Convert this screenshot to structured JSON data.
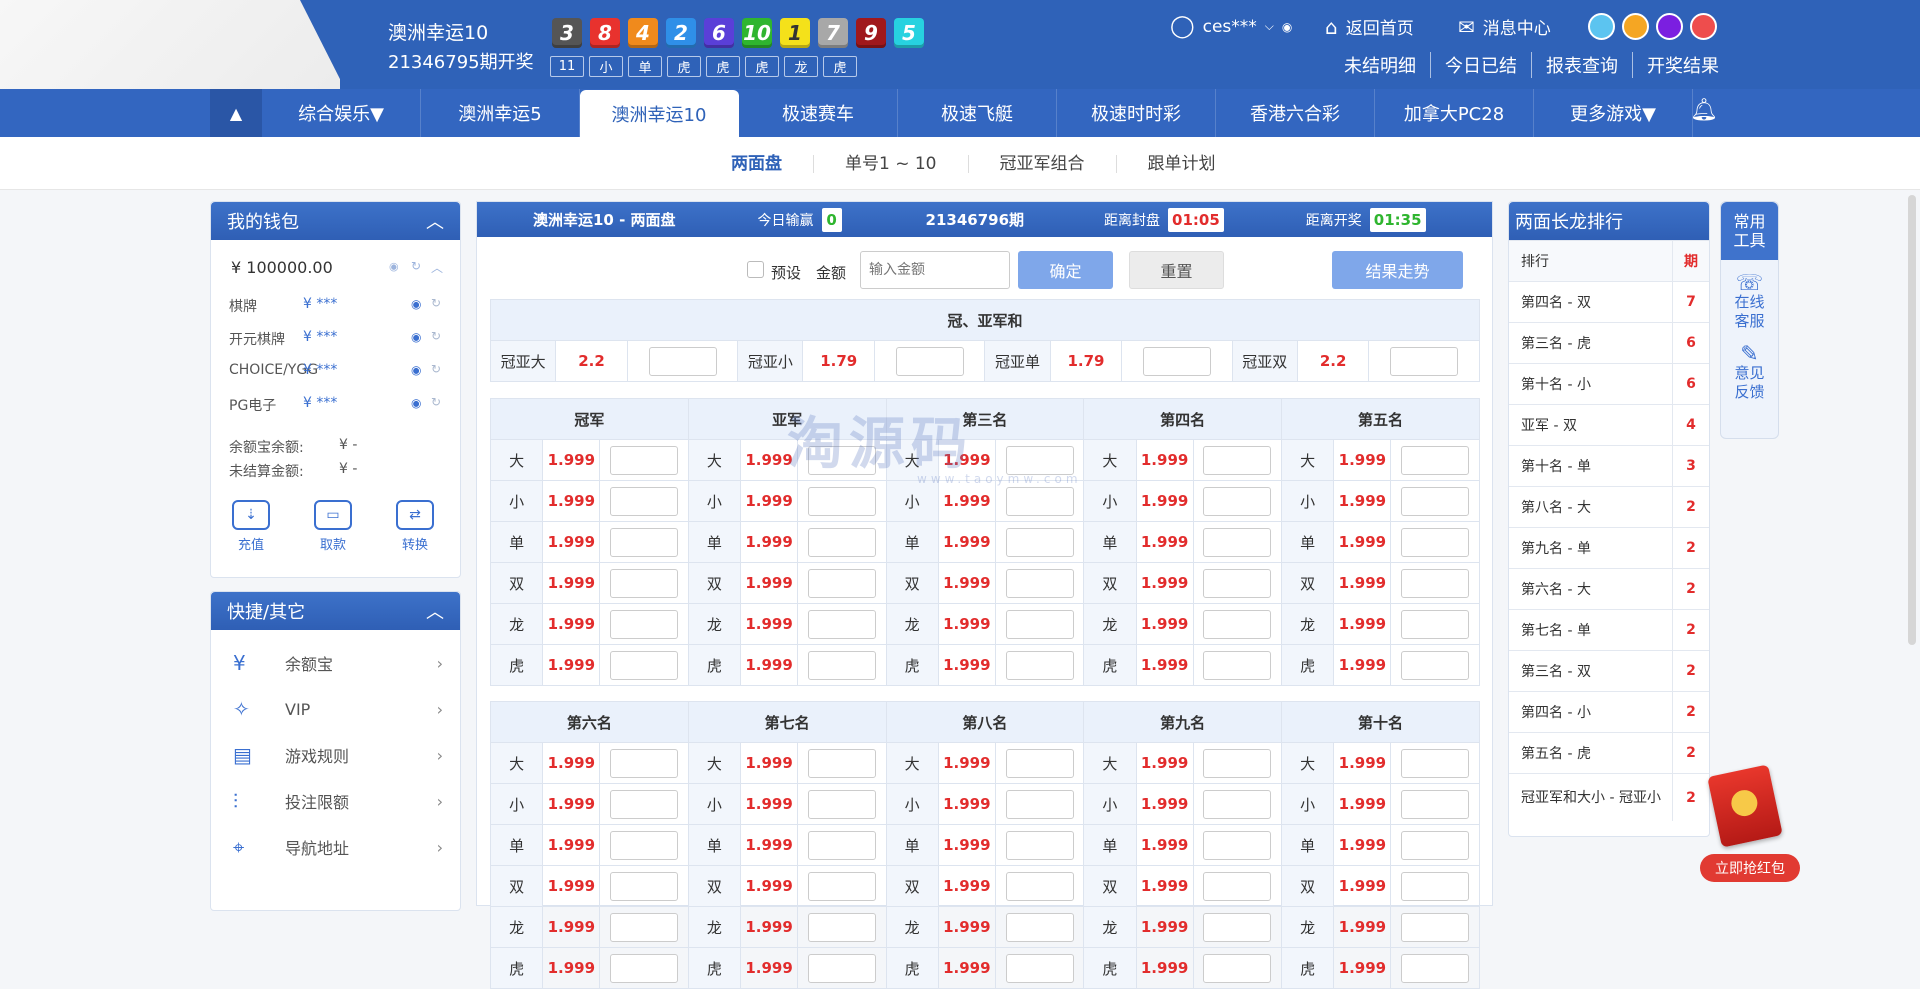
{
  "header": {
    "game_title": "澳洲幸运10",
    "period_text": "21346795期开奖",
    "balls": [
      {
        "n": "3",
        "c": "#555555"
      },
      {
        "n": "8",
        "c": "#e8322e"
      },
      {
        "n": "4",
        "c": "#f08a1c"
      },
      {
        "n": "2",
        "c": "#2f8fe8"
      },
      {
        "n": "6",
        "c": "#5a3fd8"
      },
      {
        "n": "10",
        "c": "#2fb52f"
      },
      {
        "n": "1",
        "c": "#f4e11a"
      },
      {
        "n": "7",
        "c": "#a8a8a8"
      },
      {
        "n": "9",
        "c": "#a0181c"
      },
      {
        "n": "5",
        "c": "#27d2e0"
      }
    ],
    "tags": [
      "11",
      "小",
      "单",
      "虎",
      "虎",
      "虎",
      "龙",
      "虎"
    ],
    "user": "ces***",
    "home": "返回首页",
    "messages": "消息中心",
    "sublinks": [
      "未结明细",
      "今日已结",
      "报表查询",
      "开奖结果"
    ],
    "theme_colors": [
      "#5cc4f0",
      "#f5a623",
      "#7b1fe0",
      "#ee4d4d"
    ]
  },
  "nav": {
    "items": [
      "综合娱乐▼",
      "澳洲幸运5",
      "澳洲幸运10",
      "极速赛车",
      "极速飞艇",
      "极速时时彩",
      "香港六合彩",
      "加拿大PC28",
      "更多游戏▼"
    ],
    "active": 2
  },
  "subnav": {
    "items": [
      "两面盘",
      "单号1 ~ 10",
      "冠亚军组合",
      "跟单计划"
    ],
    "active": 0
  },
  "wallet": {
    "title": "我的钱包",
    "balance": "¥ 100000.00",
    "rows": [
      {
        "name": "棋牌",
        "val": "¥ ***"
      },
      {
        "name": "开元棋牌",
        "val": "¥ ***"
      },
      {
        "name": "CHOICE/YGG",
        "val": "¥ ***"
      },
      {
        "name": "PG电子",
        "val": "¥ ***"
      }
    ],
    "yuebao_label": "余额宝余额:",
    "yuebao_val": "¥ -",
    "unsettled_label": "未结算金额:",
    "unsettled_val": "¥ -",
    "actions": [
      "充值",
      "取款",
      "转换"
    ]
  },
  "quick": {
    "title": "快捷/其它",
    "items": [
      {
        "icon": "coin-bag-icon",
        "label": "余额宝"
      },
      {
        "icon": "vip-diamond-icon",
        "label": "VIP"
      },
      {
        "icon": "rules-doc-icon",
        "label": "游戏规则"
      },
      {
        "icon": "sliders-icon",
        "label": "投注限额"
      },
      {
        "icon": "location-pin-icon",
        "label": "导航地址"
      }
    ]
  },
  "main": {
    "title": "澳洲幸运10 - 两面盘",
    "today_label": "今日输赢",
    "today_value": "0",
    "period": "21346796期",
    "close_label": "距离封盘",
    "close_time": "01:05",
    "open_label": "距离开奖",
    "open_time": "01:35",
    "preset": "预设",
    "amount_label": "金额",
    "amount_placeholder": "输入金额",
    "confirm": "确定",
    "reset": "重置",
    "trend": "结果走势",
    "sum_title": "冠、亚军和",
    "sum_cells": [
      {
        "label": "冠亚大",
        "odds": "2.2"
      },
      {
        "label": "冠亚小",
        "odds": "1.79"
      },
      {
        "label": "冠亚单",
        "odds": "1.79"
      },
      {
        "label": "冠亚双",
        "odds": "2.2"
      }
    ],
    "section1": [
      "冠军",
      "亚军",
      "第三名",
      "第四名",
      "第五名"
    ],
    "section2": [
      "第六名",
      "第七名",
      "第八名",
      "第九名",
      "第十名"
    ],
    "bet_types": [
      "大",
      "小",
      "单",
      "双",
      "龙",
      "虎"
    ],
    "odds": "1.999"
  },
  "ranking": {
    "title": "两面长龙排行",
    "header": {
      "name": "排行",
      "val": "期"
    },
    "rows": [
      {
        "name": "第四名 - 双",
        "val": "7"
      },
      {
        "name": "第三名 - 虎",
        "val": "6"
      },
      {
        "name": "第十名 - 小",
        "val": "6"
      },
      {
        "name": "亚军 - 双",
        "val": "4"
      },
      {
        "name": "第十名 - 单",
        "val": "3"
      },
      {
        "name": "第八名 - 大",
        "val": "2"
      },
      {
        "name": "第九名 - 单",
        "val": "2"
      },
      {
        "name": "第六名 - 大",
        "val": "2"
      },
      {
        "name": "第七名 - 单",
        "val": "2"
      },
      {
        "name": "第三名 - 双",
        "val": "2"
      },
      {
        "name": "第四名 - 小",
        "val": "2"
      },
      {
        "name": "第五名 - 虎",
        "val": "2"
      },
      {
        "name": "冠亚军和大小 - 冠亚小",
        "val": "2"
      }
    ]
  },
  "tools": {
    "title": "常用工具",
    "items": [
      "在线客服",
      "意见反馈"
    ]
  },
  "redpack": {
    "label": "立即抢红包"
  }
}
